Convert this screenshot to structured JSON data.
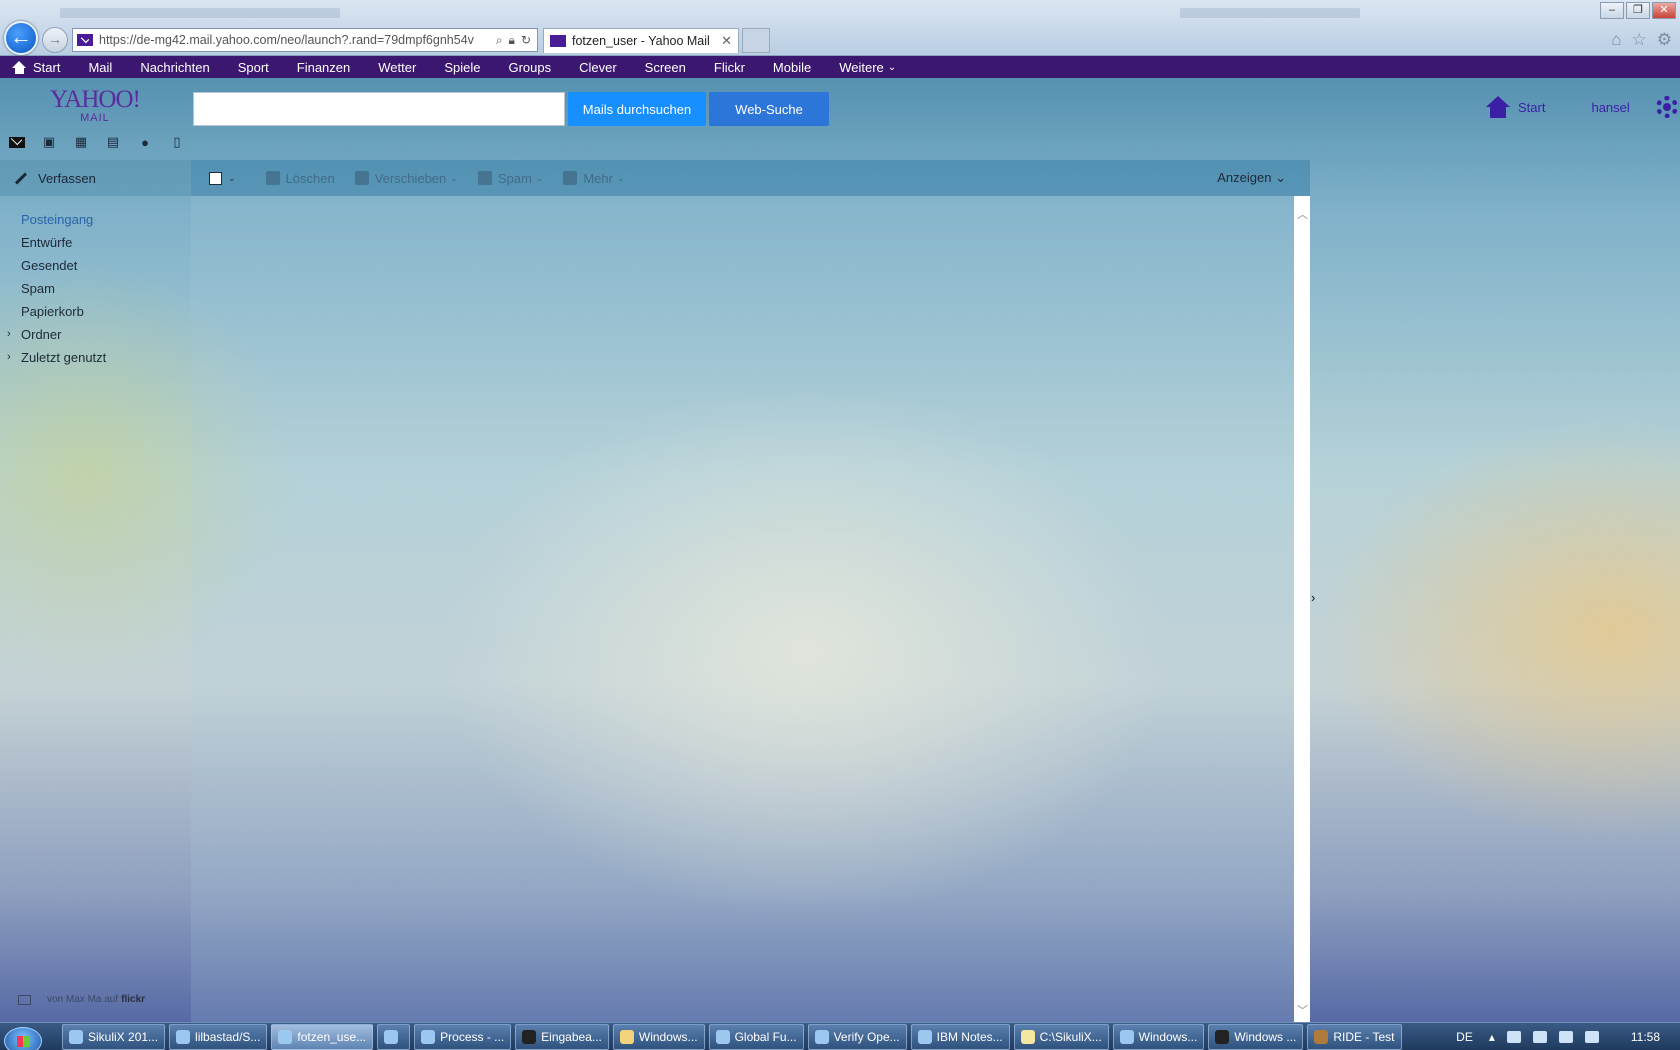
{
  "browser": {
    "url": "https://de-mg42.mail.yahoo.com/neo/launch?.rand=79dmpf6gnh54v",
    "tab_title": "fotzen_user - Yahoo Mail",
    "tab_close": "✕",
    "back": "←",
    "forward": "→"
  },
  "topnav": {
    "items": [
      "Start",
      "Mail",
      "Nachrichten",
      "Sport",
      "Finanzen",
      "Wetter",
      "Spiele",
      "Groups",
      "Clever",
      "Screen",
      "Flickr",
      "Mobile",
      "Weitere"
    ]
  },
  "header": {
    "logo_main": "YAHOO!",
    "logo_sub": "MAIL",
    "search_placeholder": "",
    "search_mail_button": "Mails durchsuchen",
    "web_search_button": "Web-Suche",
    "home_label": "Start",
    "username": "hansel"
  },
  "apps": [
    "mail-icon",
    "contacts-icon",
    "calendar-icon",
    "notepad-icon",
    "messenger-icon",
    "mobile-icon"
  ],
  "sidebar": {
    "compose": "Verfassen",
    "folders": [
      "Posteingang",
      "Entwürfe",
      "Gesendet",
      "Spam",
      "Papierkorb",
      "Ordner",
      "Zuletzt genutzt"
    ],
    "active_folder": "Posteingang",
    "credit_prefix": "von Max Ma auf",
    "credit_site": "flickr"
  },
  "toolbar": {
    "delete": "Löschen",
    "move": "Verschieben",
    "spam": "Spam",
    "more": "Mehr",
    "view": "Anzeigen"
  },
  "taskbar": {
    "tasks": [
      "SikuliX 201...",
      "lilbastad/S...",
      "fotzen_use...",
      "",
      "Process - ...",
      "Eingabea...",
      "Windows...",
      "Global Fu...",
      "Verify Ope...",
      "IBM Notes...",
      "C:\\SikuliX...",
      "Windows...",
      "Windows ...",
      "RIDE - Test"
    ],
    "active_task": "fotzen_use...",
    "language": "DE",
    "clock": "11:58"
  }
}
